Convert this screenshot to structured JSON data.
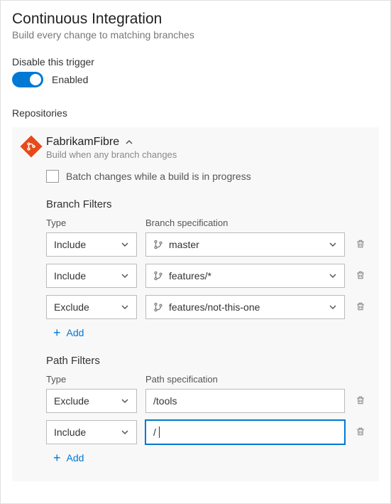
{
  "header": {
    "title": "Continuous Integration",
    "subtitle": "Build every change to matching branches"
  },
  "trigger": {
    "label": "Disable this trigger",
    "enabled": true,
    "status": "Enabled"
  },
  "repositories": {
    "label": "Repositories",
    "repo": {
      "name": "FabrikamFibre",
      "subtext": "Build when any branch changes",
      "batch_label": "Batch changes while a build is in progress"
    }
  },
  "branch_filters": {
    "heading": "Branch Filters",
    "type_header": "Type",
    "spec_header": "Branch specification",
    "rows": [
      {
        "type": "Include",
        "spec": "master"
      },
      {
        "type": "Include",
        "spec": "features/*"
      },
      {
        "type": "Exclude",
        "spec": "features/not-this-one"
      }
    ],
    "add_label": "Add"
  },
  "path_filters": {
    "heading": "Path Filters",
    "type_header": "Type",
    "spec_header": "Path specification",
    "rows": [
      {
        "type": "Exclude",
        "spec": "/tools",
        "focused": false
      },
      {
        "type": "Include",
        "spec": "/",
        "focused": true
      }
    ],
    "add_label": "Add"
  }
}
